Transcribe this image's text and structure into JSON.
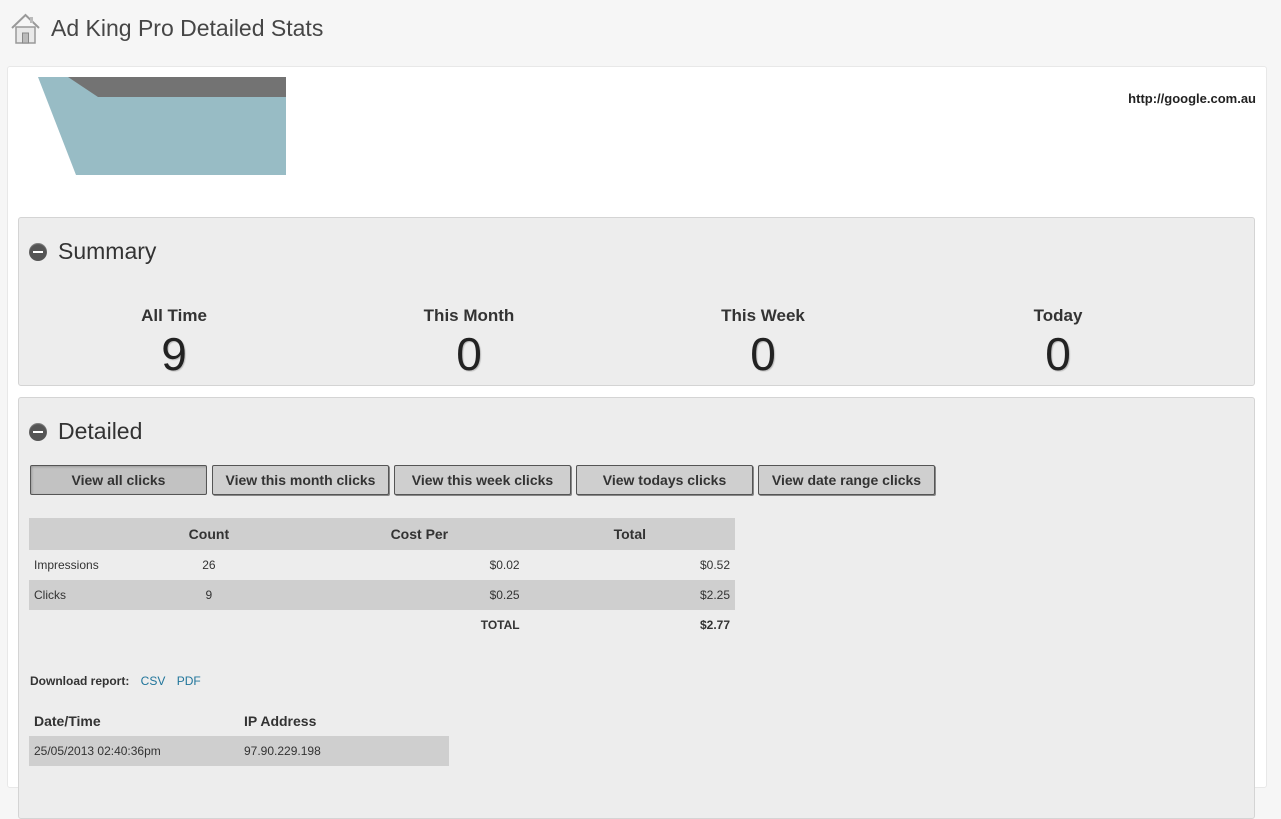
{
  "header": {
    "title": "Ad King Pro Detailed Stats",
    "icon": "home-icon"
  },
  "ad": {
    "url": "http://google.com.au"
  },
  "summary": {
    "title": "Summary",
    "stats": [
      {
        "label": "All Time",
        "value": "9"
      },
      {
        "label": "This Month",
        "value": "0"
      },
      {
        "label": "This Week",
        "value": "0"
      },
      {
        "label": "Today",
        "value": "0"
      }
    ]
  },
  "detailed": {
    "title": "Detailed",
    "buttons": [
      "View all clicks",
      "View this month clicks",
      "View this week clicks",
      "View todays clicks",
      "View date range clicks"
    ],
    "table": {
      "headers": [
        "",
        "Count",
        "Cost Per",
        "Total"
      ],
      "rows": [
        {
          "label": "Impressions",
          "count": "26",
          "cost_per": "$0.02",
          "total": "$0.52"
        },
        {
          "label": "Clicks",
          "count": "9",
          "cost_per": "$0.25",
          "total": "$2.25"
        }
      ],
      "total_label": "TOTAL",
      "total_value": "$2.77"
    },
    "download": {
      "label": "Download report:",
      "csv": "CSV",
      "pdf": "PDF"
    },
    "clicks_table": {
      "headers": [
        "Date/Time",
        "IP Address"
      ],
      "rows": [
        {
          "datetime": "25/05/2013 02:40:36pm",
          "ip": "97.90.229.198"
        }
      ]
    }
  }
}
